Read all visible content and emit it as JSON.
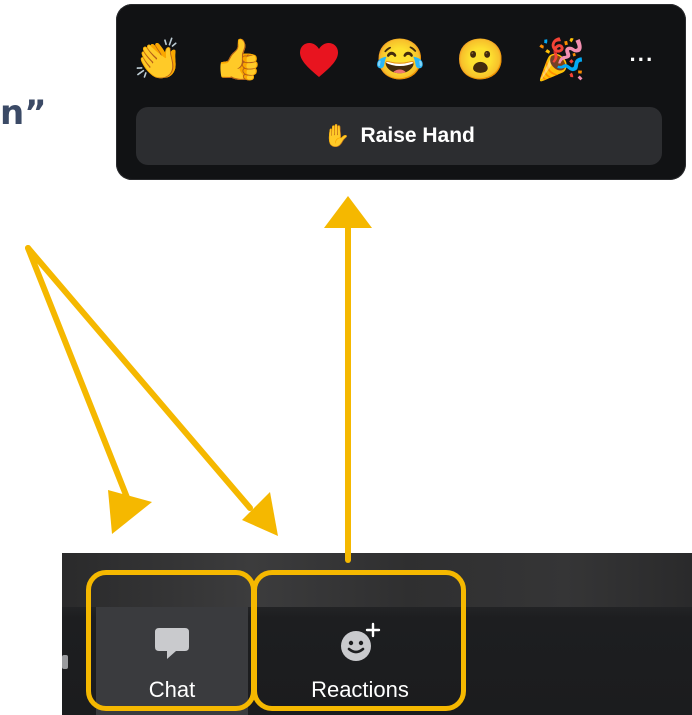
{
  "heading": {
    "fragment": "n”"
  },
  "reactions_popup": {
    "emojis": [
      {
        "name": "clapping-hands",
        "glyph": "👏"
      },
      {
        "name": "thumbs-up",
        "glyph": "👍"
      },
      {
        "name": "red-heart",
        "glyph": "❤️"
      },
      {
        "name": "tears-of-joy",
        "glyph": "😂"
      },
      {
        "name": "open-mouth",
        "glyph": "😮"
      },
      {
        "name": "party-popper",
        "glyph": "🎉"
      }
    ],
    "more_label": "···",
    "raise_hand_icon": "✋",
    "raise_hand_label": "Raise Hand"
  },
  "toolbar": {
    "chat_label": "Chat",
    "chat_icon": "chat-bubble-icon",
    "reactions_label": "Reactions",
    "reactions_icon": "smiley-plus-icon"
  },
  "colors": {
    "highlight": "#f5b800",
    "popup_bg": "#111214",
    "toolbar_bg": "#1b1c1e"
  }
}
